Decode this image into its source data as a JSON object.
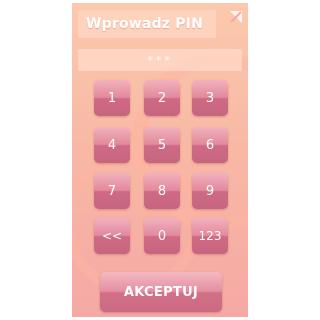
{
  "header": {
    "title": "Wprowadz PIN",
    "corner_icon": "expand-arrow-icon"
  },
  "pin_display": {
    "masked_value": "***"
  },
  "keypad": {
    "keys": [
      "1",
      "2",
      "3",
      "4",
      "5",
      "6",
      "7",
      "8",
      "9",
      "<<",
      "0",
      "123"
    ]
  },
  "accept_button": {
    "label": "AKCEPTUJ"
  },
  "colors": {
    "panel_top": "#fbc9ae",
    "panel_bottom": "#f5a9a4",
    "key_light": "#f2b2bd",
    "key_dark": "#c76580",
    "text": "#ffffff"
  }
}
